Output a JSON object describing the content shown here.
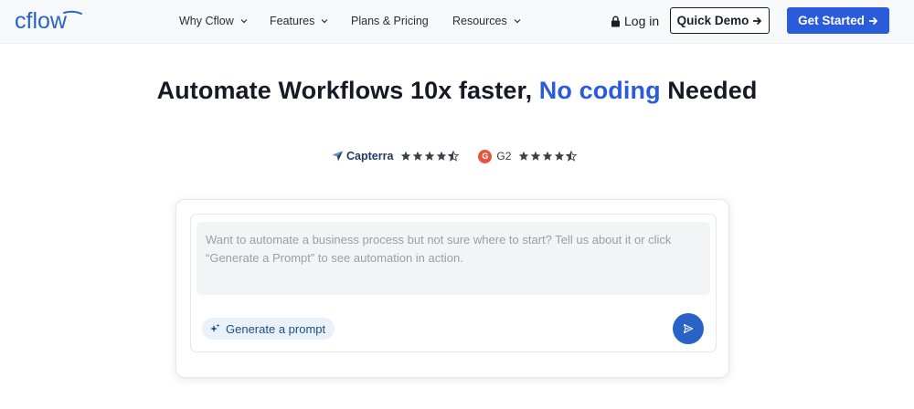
{
  "header": {
    "logo_text": "cflow",
    "nav": [
      {
        "label": "Why Cflow",
        "has_dropdown": true
      },
      {
        "label": "Features",
        "has_dropdown": true
      },
      {
        "label": "Plans & Pricing",
        "has_dropdown": false
      },
      {
        "label": "Resources",
        "has_dropdown": true
      }
    ],
    "login_label": "Log in",
    "quick_demo_label": "Quick Demo",
    "get_started_label": "Get Started"
  },
  "hero": {
    "title_part1": "Automate Workflows 10x faster, ",
    "title_accent": "No coding",
    "title_part2": " Needed"
  },
  "ratings": {
    "capterra_label": "Capterra",
    "capterra_stars": 4.5,
    "g2_badge": "G",
    "g2_label": "G2",
    "g2_stars": 4.5
  },
  "prompt_box": {
    "placeholder": "Want to automate a business process but not sure where to start? Tell us about it or click “Generate a Prompt” to see automation in action.",
    "value": "",
    "generate_label": "Generate a prompt"
  },
  "colors": {
    "accent": "#2a5bdb",
    "title": "#161a26",
    "card_border": "#e4e6ea",
    "pill_bg": "#e9f1fb",
    "g2_red": "#e5553a"
  },
  "icons": {
    "lock": "lock-icon",
    "arrow": "arrow-right-icon",
    "chevron": "chevron-down-icon",
    "star": "star-icon",
    "sparkle": "sparkle-icon",
    "send": "send-icon"
  }
}
